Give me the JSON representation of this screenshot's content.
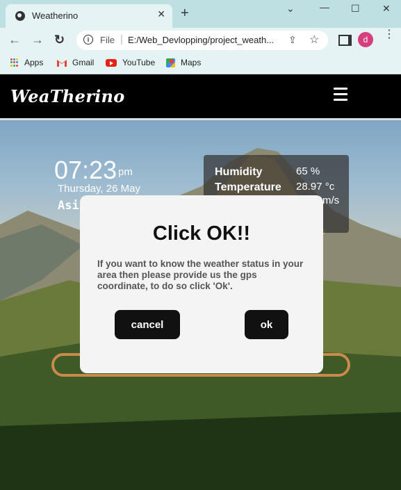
{
  "browser": {
    "tab_title": "Weatherino",
    "url_prefix": "File",
    "url": "E:/Web_Devlopping/project_weath...",
    "profile_initial": "d",
    "bookmarks": [
      {
        "label": "Apps",
        "icon": "apps-icon"
      },
      {
        "label": "Gmail",
        "icon": "gmail-icon"
      },
      {
        "label": "YouTube",
        "icon": "youtube-icon"
      },
      {
        "label": "Maps",
        "icon": "maps-icon"
      }
    ]
  },
  "site": {
    "logo": "WeaTherino"
  },
  "clock": {
    "time": "07:23",
    "ampm": "pm",
    "date": "Thursday, 26 May",
    "zone": "Asi"
  },
  "weather": {
    "rows": [
      {
        "label": "Humidity",
        "value": "65 %"
      },
      {
        "label": "Temperature",
        "value": "28.97 °c"
      },
      {
        "label": "",
        "value": "m/s"
      }
    ]
  },
  "dialog": {
    "title": "Click OK!!",
    "message": "If you want to know the weather status in your area then please provide us the gps coordinate, to do so click 'Ok'.",
    "cancel_label": "cancel",
    "ok_label": "ok"
  },
  "colors": {
    "header_bg": "#000000",
    "search_ring": "#c98a4b",
    "button_bg": "#111111",
    "dialog_bg": "#f4f4f4"
  }
}
